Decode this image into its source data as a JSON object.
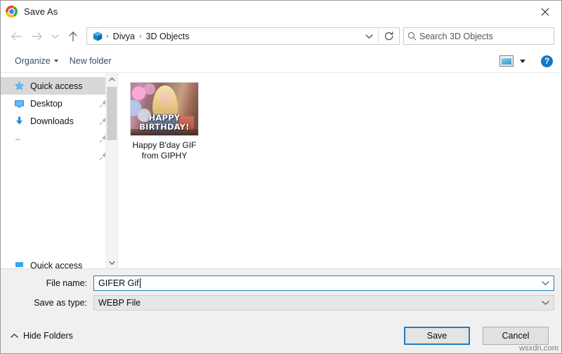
{
  "window": {
    "title": "Save As",
    "app_icon": "chrome-icon",
    "close_label": "✕"
  },
  "navigation": {
    "back_icon": "arrow-left-icon",
    "forward_icon": "arrow-right-icon",
    "recent_icon": "chevron-down-icon",
    "up_icon": "arrow-up-icon",
    "breadcrumb": {
      "folder_icon": "3d-objects-icon",
      "separator": "›",
      "items": [
        "Divya",
        "3D Objects"
      ]
    },
    "address_chevron_icon": "chevron-down-icon",
    "refresh_icon": "refresh-icon"
  },
  "search": {
    "icon": "search-icon",
    "placeholder": "Search 3D Objects",
    "value": ""
  },
  "toolbar": {
    "organize_label": "Organize",
    "new_folder_label": "New folder",
    "view_icon": "view-layout-icon",
    "view_caret_icon": "caret-down-icon",
    "help_label": "?",
    "help_icon": "help-icon"
  },
  "sidebar": {
    "items": [
      {
        "label": "Quick access",
        "icon": "star-icon",
        "selected": true,
        "pinned": false
      },
      {
        "label": "Desktop",
        "icon": "desktop-icon",
        "selected": false,
        "pinned": true
      },
      {
        "label": "Downloads",
        "icon": "download-icon",
        "selected": false,
        "pinned": true
      },
      {
        "label": "",
        "icon": "folder-icon",
        "selected": false,
        "pinned": true
      },
      {
        "label": "",
        "icon": "folder-icon",
        "selected": false,
        "pinned": true
      }
    ],
    "clipped_item_label": "Quick access",
    "scrollbar": {
      "up_icon": "chevron-up-icon",
      "down_icon": "chevron-down-icon"
    }
  },
  "files": [
    {
      "name": "Happy B'day GIF\nfrom GIPHY",
      "thumbnail_caption_line1": "HAPPY",
      "thumbnail_caption_line2": "BIRTHDAY!"
    }
  ],
  "form": {
    "filename_label": "File name:",
    "filename_value": "GIFER Gif",
    "filename_chevron_icon": "chevron-down-icon",
    "savetype_label": "Save as type:",
    "savetype_value": "WEBP File",
    "savetype_chevron_icon": "chevron-down-icon"
  },
  "footer": {
    "hide_folders_label": "Hide Folders",
    "hide_folders_icon": "chevron-up-icon",
    "save_label": "Save",
    "cancel_label": "Cancel"
  },
  "watermark": "wsxdn.com",
  "colors": {
    "accent": "#1f7ec0",
    "selection": "#d8d8d8",
    "form_bg": "#f0f0f0",
    "help_blue": "#1277c4"
  }
}
